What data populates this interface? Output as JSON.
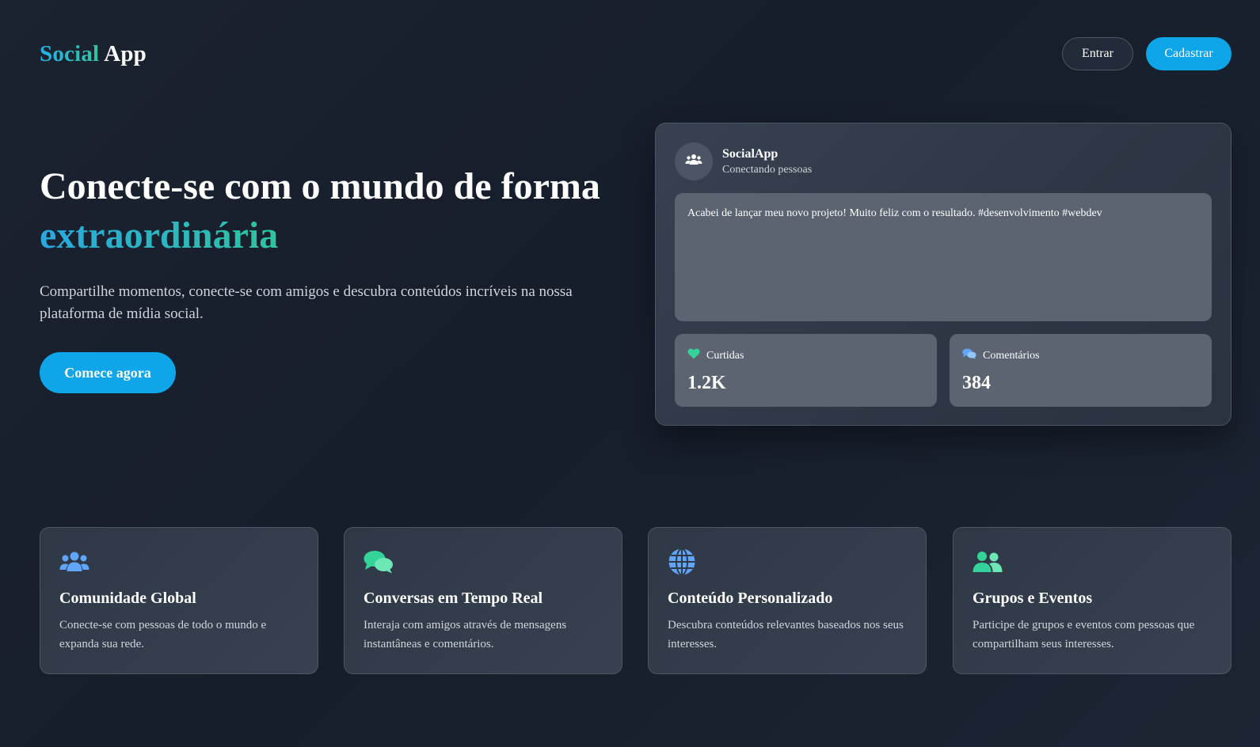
{
  "header": {
    "logo_part1": "Social",
    "logo_part2": "App",
    "login_label": "Entrar",
    "signup_label": "Cadastrar"
  },
  "hero": {
    "title_line1": "Conecte-se com o mundo de forma",
    "title_accent": "extraordinária",
    "subtitle": "Compartilhe momentos, conecte-se com amigos e descubra conteúdos incríveis na nossa plataforma de mídia social.",
    "cta_label": "Comece agora"
  },
  "post": {
    "avatar_icon": "users-icon",
    "name": "SocialApp",
    "tagline": "Conectando pessoas",
    "body": "Acabei de lançar meu novo projeto! Muito feliz com o resultado. #desenvolvimento #webdev",
    "stats": [
      {
        "icon": "heart-icon",
        "label": "Curtidas",
        "value": "1.2K"
      },
      {
        "icon": "comments-icon",
        "label": "Comentários",
        "value": "384"
      }
    ]
  },
  "features": [
    {
      "icon": "users-icon",
      "title": "Comunidade Global",
      "desc": "Conecte-se com pessoas de todo o mundo e expanda sua rede."
    },
    {
      "icon": "comments-icon",
      "title": "Conversas em Tempo Real",
      "desc": "Interaja com amigos através de mensagens instantâneas e comentários."
    },
    {
      "icon": "globe-icon",
      "title": "Conteúdo Personalizado",
      "desc": "Descubra conteúdos relevantes baseados nos seus interesses."
    },
    {
      "icon": "user-friends-icon",
      "title": "Grupos e Eventos",
      "desc": "Participe de grupos e eventos com pessoas que compartilham seus interesses."
    }
  ],
  "colors": {
    "accent_blue": "#0ea5e9",
    "accent_green": "#2ec4a0",
    "icon_blue": "#60a5fa",
    "icon_green": "#34d399",
    "background": "#1b2230"
  }
}
